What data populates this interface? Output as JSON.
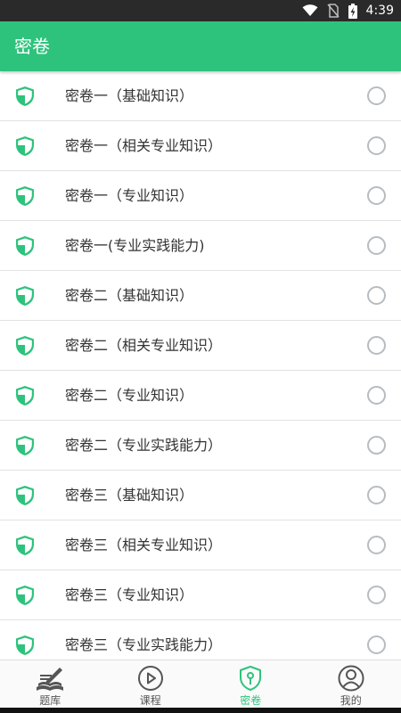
{
  "status_bar": {
    "time": "4:39",
    "icons": [
      "wifi-icon",
      "no-sim-icon",
      "battery-charging-icon"
    ]
  },
  "app_bar": {
    "title": "密卷"
  },
  "colors": {
    "primary": "#2ec37c",
    "status_bar": "#2a2a2a",
    "radio_border": "#b6bcc0",
    "text": "#333333"
  },
  "list": {
    "items": [
      {
        "label": "密卷一（基础知识）",
        "icon": "shield-icon",
        "selected": false
      },
      {
        "label": "密卷一（相关专业知识）",
        "icon": "shield-icon",
        "selected": false
      },
      {
        "label": "密卷一（专业知识）",
        "icon": "shield-icon",
        "selected": false
      },
      {
        "label": "密卷一(专业实践能力)",
        "icon": "shield-icon",
        "selected": false
      },
      {
        "label": "密卷二（基础知识）",
        "icon": "shield-icon",
        "selected": false
      },
      {
        "label": "密卷二（相关专业知识）",
        "icon": "shield-icon",
        "selected": false
      },
      {
        "label": "密卷二（专业知识）",
        "icon": "shield-icon",
        "selected": false
      },
      {
        "label": "密卷二（专业实践能力）",
        "icon": "shield-icon",
        "selected": false
      },
      {
        "label": "密卷三（基础知识）",
        "icon": "shield-icon",
        "selected": false
      },
      {
        "label": "密卷三（相关专业知识）",
        "icon": "shield-icon",
        "selected": false
      },
      {
        "label": "密卷三（专业知识）",
        "icon": "shield-icon",
        "selected": false
      },
      {
        "label": "密卷三（专业实践能力）",
        "icon": "shield-icon",
        "selected": false
      }
    ]
  },
  "bottom_nav": {
    "tabs": [
      {
        "label": "题库",
        "icon": "question-bank-icon",
        "active": false
      },
      {
        "label": "课程",
        "icon": "play-circle-icon",
        "active": false
      },
      {
        "label": "密卷",
        "icon": "shield-key-icon",
        "active": true
      },
      {
        "label": "我的",
        "icon": "user-icon",
        "active": false
      }
    ]
  }
}
